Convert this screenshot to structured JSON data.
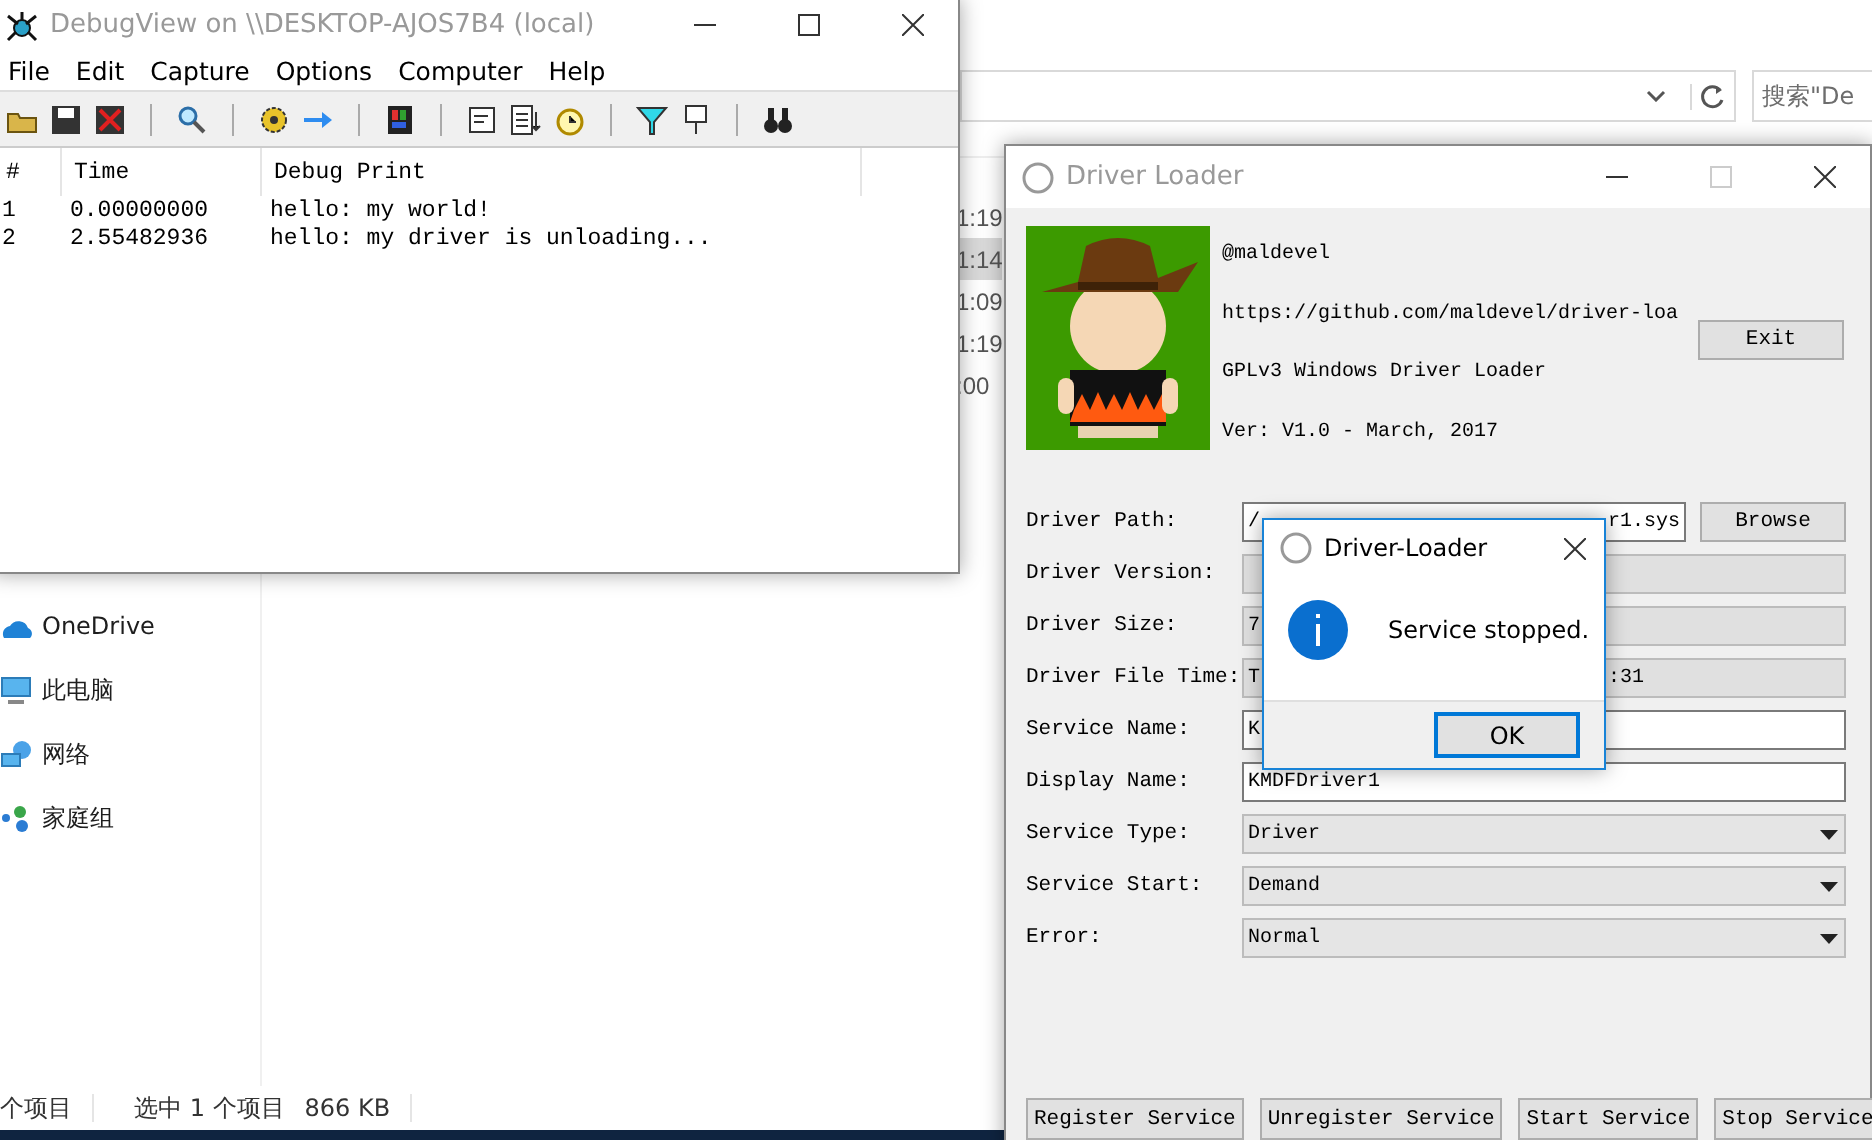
{
  "explorer": {
    "search_placeholder": "搜索\"De",
    "times": [
      {
        "text": "1:19",
        "selected": false
      },
      {
        "text": "1:14",
        "selected": true
      },
      {
        "text": "1:09",
        "selected": false
      },
      {
        "text": "1:19",
        "selected": false
      },
      {
        "text": ":00",
        "selected": false
      }
    ],
    "nav_items": [
      {
        "label": "OneDrive",
        "kind": "cloud"
      },
      {
        "label": "此电脑",
        "kind": "computer"
      },
      {
        "label": "网络",
        "kind": "network"
      },
      {
        "label": "家庭组",
        "kind": "homegroup"
      }
    ],
    "status_bar": {
      "count": "个项目",
      "selection": "选中 1 个项目",
      "size": "866 KB"
    }
  },
  "debugview": {
    "title": "DebugView on \\\\DESKTOP-AJOS7B4 (local)",
    "menu": [
      "File",
      "Edit",
      "Capture",
      "Options",
      "Computer",
      "Help"
    ],
    "columns": [
      "#",
      "Time",
      "Debug Print"
    ],
    "rows": [
      {
        "index": "1",
        "time": "0.00000000",
        "message": "hello: my world!"
      },
      {
        "index": "2",
        "time": "2.55482936",
        "message": "hello: my driver is unloading..."
      }
    ]
  },
  "driver_loader": {
    "title": "Driver Loader",
    "info": [
      "@maldevel",
      "https://github.com/maldevel/driver-loa",
      "GPLv3 Windows Driver Loader",
      "Ver: V1.0 - March, 2017"
    ],
    "exit_button": "Exit",
    "fields": [
      {
        "label": "Driver Path:",
        "kind": "text",
        "value": "/",
        "value_end": "r1.sys",
        "button": "Browse"
      },
      {
        "label": "Driver Version:",
        "kind": "readonly"
      },
      {
        "label": "Driver Size:",
        "kind": "readonly",
        "value": "7"
      },
      {
        "label": "Driver File Time:",
        "kind": "readonly",
        "value": "T",
        "value_end": ":31"
      },
      {
        "label": "Service Name:",
        "kind": "text",
        "value": "K"
      },
      {
        "label": "Display Name:",
        "kind": "text",
        "value": "KMDFDriver1"
      },
      {
        "label": "Service Type:",
        "kind": "combo",
        "value": "Driver"
      },
      {
        "label": "Service Start:",
        "kind": "combo",
        "value": "Demand"
      },
      {
        "label": "Error:",
        "kind": "combo",
        "value": "Normal"
      }
    ],
    "buttons": [
      "Register Service",
      "Unregister Service",
      "Start Service",
      "Stop Service"
    ]
  },
  "dialog": {
    "title": "Driver-Loader",
    "message": "Service stopped.",
    "button": "OK"
  }
}
